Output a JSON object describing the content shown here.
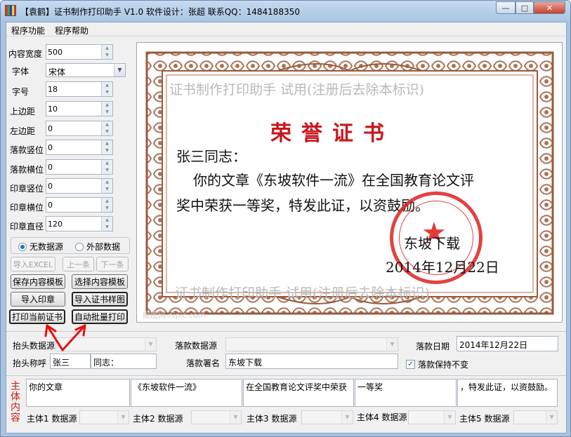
{
  "window": {
    "title": "【袁鹤】证书制作打印助手 V1.0    软件设计：张超  联系QQ：1484188350",
    "min_glyph": "—",
    "max_glyph": "□",
    "close_glyph": "✕"
  },
  "menu": {
    "items": [
      {
        "label": "程序功能"
      },
      {
        "label": "程序帮助"
      }
    ]
  },
  "fields": [
    {
      "label": "内容宽度",
      "value": "500"
    },
    {
      "label": "字体",
      "value": "宋体"
    },
    {
      "label": "字号",
      "value": "18"
    },
    {
      "label": "上边距",
      "value": "10"
    },
    {
      "label": "左边距",
      "value": "0"
    },
    {
      "label": "落款竖位",
      "value": "0"
    },
    {
      "label": "落款横位",
      "value": "0"
    },
    {
      "label": "印章竖位",
      "value": "0"
    },
    {
      "label": "印章横位",
      "value": "0"
    },
    {
      "label": "印章直径",
      "value": "120"
    }
  ],
  "data_source": {
    "none_label": "无数据源",
    "external_label": "外部数据",
    "selected": "none"
  },
  "nav_buttons": {
    "import_excel": "导入EXCEL",
    "prev": "上一条",
    "next": "下一条"
  },
  "action_buttons": {
    "save_template": "保存内容模板",
    "choose_template": "选择内容模板",
    "import_seal": "导入印章",
    "import_sample": "导入证书样图",
    "print_current": "打印当前证书",
    "auto_batch_print": "自动批量打印"
  },
  "certificate": {
    "watermark_top": "证书制作打印助手 试用(注册后去除本标识)",
    "watermark_bottom": "证书制作打印助手  试用(注册后去除本标识)",
    "heading": "荣誉证书",
    "salutation": "张三同志：",
    "line1": "你的文章《东坡软件一流》在全国教育论文评",
    "line2": "奖中荣获一等奖，特发此证，以资鼓励。",
    "signature": "东坡下载",
    "date": "2014年12月22日",
    "corner_mark": "昵图网 nipic.com"
  },
  "bottom_form": {
    "header_source_label": "抬头数据源",
    "header_name_label": "抬头称呼",
    "header_name_value": "张三",
    "header_suffix_value": "同志：",
    "sign_source_label": "落款数据源",
    "sign_name_label": "落款署名",
    "sign_name_value": "东坡下载",
    "sign_date_label": "落款日期",
    "sign_date_value": "2014年12月22日",
    "keep_sign_label": "落款保持不变",
    "keep_sign_checked": "✓"
  },
  "body_section": {
    "label": "主体内容",
    "parts": [
      {
        "text": "你的文章",
        "source_label": "主体1 数据源"
      },
      {
        "text": "《东坡软件一流》",
        "source_label": "主体2 数据源"
      },
      {
        "text": "在全国教育论文评奖中荣获",
        "source_label": "主体3 数据源"
      },
      {
        "text": "一等奖",
        "source_label": "主体4 数据源"
      },
      {
        "text": "，特发此证，以资鼓励。",
        "source_label": "主体5 数据源"
      }
    ]
  },
  "colors": {
    "title_red": "#c8161d",
    "seal_red": "#e02020",
    "frame_brown": "#9a5a3a",
    "annotation_red": "#e81010"
  }
}
